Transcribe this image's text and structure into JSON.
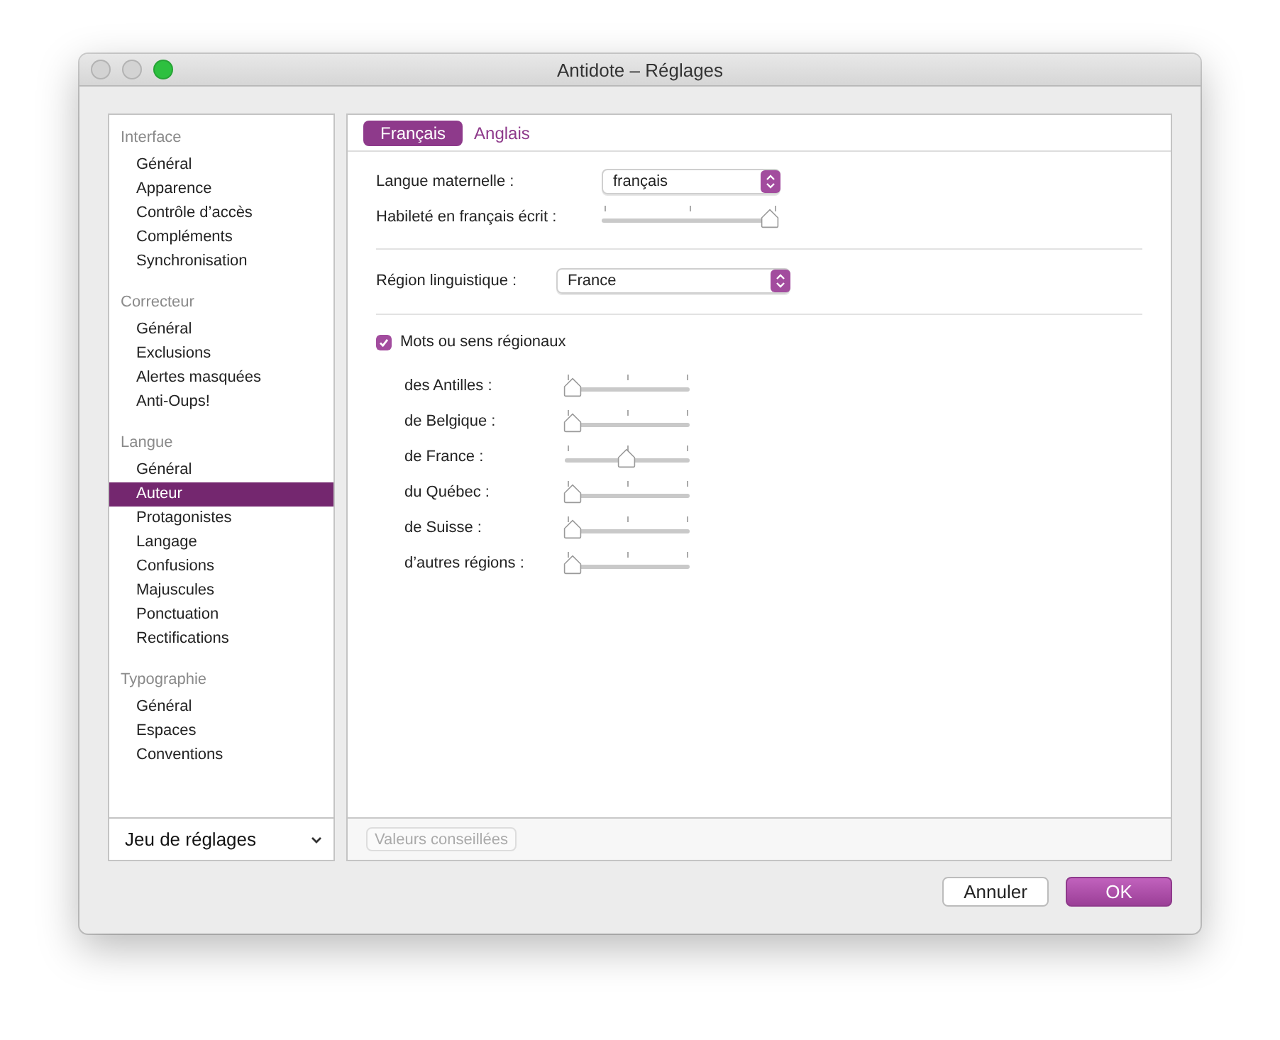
{
  "window": {
    "title": "Antidote – Réglages"
  },
  "sidebar": {
    "sections": [
      {
        "title": "Interface",
        "items": [
          {
            "label": "Général",
            "selected": false
          },
          {
            "label": "Apparence",
            "selected": false
          },
          {
            "label": "Contrôle d’accès",
            "selected": false
          },
          {
            "label": "Compléments",
            "selected": false
          },
          {
            "label": "Synchronisation",
            "selected": false
          }
        ]
      },
      {
        "title": "Correcteur",
        "items": [
          {
            "label": "Général",
            "selected": false
          },
          {
            "label": "Exclusions",
            "selected": false
          },
          {
            "label": "Alertes masquées",
            "selected": false
          },
          {
            "label": "Anti-Oups!",
            "selected": false
          }
        ]
      },
      {
        "title": "Langue",
        "items": [
          {
            "label": "Général",
            "selected": false
          },
          {
            "label": "Auteur",
            "selected": true
          },
          {
            "label": "Protagonistes",
            "selected": false
          },
          {
            "label": "Langage",
            "selected": false
          },
          {
            "label": "Confusions",
            "selected": false
          },
          {
            "label": "Majuscules",
            "selected": false
          },
          {
            "label": "Ponctuation",
            "selected": false
          },
          {
            "label": "Rectifications",
            "selected": false
          }
        ]
      },
      {
        "title": "Typographie",
        "items": [
          {
            "label": "Général",
            "selected": false
          },
          {
            "label": "Espaces",
            "selected": false
          },
          {
            "label": "Conventions",
            "selected": false
          }
        ]
      }
    ],
    "preset_menu": "Jeu de réglages"
  },
  "tabs": [
    {
      "label": "Français",
      "selected": true
    },
    {
      "label": "Anglais",
      "selected": false
    }
  ],
  "settings": {
    "native_language": {
      "label": "Langue maternelle :",
      "value": "français"
    },
    "skill": {
      "label": "Habileté en français écrit :",
      "level": 1
    },
    "region": {
      "label": "Région linguistique :",
      "value": "France"
    },
    "regional_words": {
      "label": "Mots ou sens régionaux",
      "checked": true
    },
    "regions": [
      {
        "label": "des Antilles :",
        "level": 0
      },
      {
        "label": "de Belgique :",
        "level": 0
      },
      {
        "label": "de France :",
        "level": 0.5
      },
      {
        "label": "du Québec :",
        "level": 0
      },
      {
        "label": "de Suisse :",
        "level": 0
      },
      {
        "label": "d’autres régions :",
        "level": 0
      }
    ]
  },
  "footer_button": {
    "label": "Valeurs conseillées",
    "disabled": true
  },
  "buttons": [
    {
      "label": "Annuler",
      "kind": "secondary"
    },
    {
      "label": "OK",
      "kind": "primary"
    }
  ]
}
